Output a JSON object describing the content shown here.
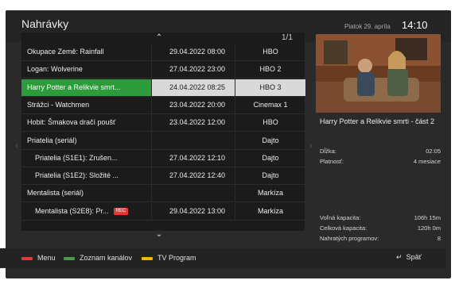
{
  "header": {
    "title": "Nahrávky",
    "date": "Piatok 29. apríla",
    "time": "14:10"
  },
  "list": {
    "page_indicator": "1/1",
    "rows": [
      {
        "name": "Okupace Země: Rainfall",
        "datetime": "29.04.2022 08:00",
        "channel": "HBO",
        "sub": false,
        "highlight": false
      },
      {
        "name": "Logan: Wolverine",
        "datetime": "27.04.2022 23:00",
        "channel": "HBO 2",
        "sub": false,
        "highlight": false
      },
      {
        "name": "Harry Potter a Relikvie smrt...",
        "datetime": "24.04.2022 08:25",
        "channel": "HBO 3",
        "sub": false,
        "highlight": true
      },
      {
        "name": "Strážci - Watchmen",
        "datetime": "23.04.2022 20:00",
        "channel": "Cinemax 1",
        "sub": false,
        "highlight": false
      },
      {
        "name": "Hobit: Šmakova dračí poušť",
        "datetime": "23.04.2022 12:00",
        "channel": "HBO",
        "sub": false,
        "highlight": false
      },
      {
        "name": "Priatelia (seriál)",
        "datetime": "",
        "channel": "Dajto",
        "sub": false,
        "highlight": false
      },
      {
        "name": "Priatelia (S1E1): Zrušen...",
        "datetime": "27.04.2022 12:10",
        "channel": "Dajto",
        "sub": true,
        "highlight": false
      },
      {
        "name": "Priatelia (S1E2): Složité ...",
        "datetime": "27.04.2022 12:40",
        "channel": "Dajto",
        "sub": true,
        "highlight": false
      },
      {
        "name": "Mentalista (seriál)",
        "datetime": "",
        "channel": "Markíza",
        "sub": false,
        "highlight": false
      },
      {
        "name": "Mentalista (S2E8): Pr...",
        "datetime": "29.04.2022 13:00",
        "channel": "Markíza",
        "sub": true,
        "highlight": false,
        "badge": "REC"
      }
    ]
  },
  "detail": {
    "title": "Harry Potter a Relikvie smrti - část 2",
    "duration_label": "Dĺžka:",
    "duration_value": "02:05",
    "validity_label": "Platnosť:",
    "validity_value": "4 mesiace",
    "free_label": "Voľná kapacita:",
    "free_value": "106h 15m",
    "total_label": "Celková kapacita:",
    "total_value": "120h 0m",
    "recorded_label": "Nahratých programov:",
    "recorded_value": "8"
  },
  "footer": {
    "menu": "Menu",
    "channels": "Zoznam kanálov",
    "tvprogram": "TV Program",
    "back": "Späť"
  },
  "colors": {
    "highlight_green": "#2d9a3c",
    "rec_red": "#e53935",
    "key_red": "#e53935",
    "key_green": "#43a047",
    "key_yellow": "#f4b400"
  }
}
